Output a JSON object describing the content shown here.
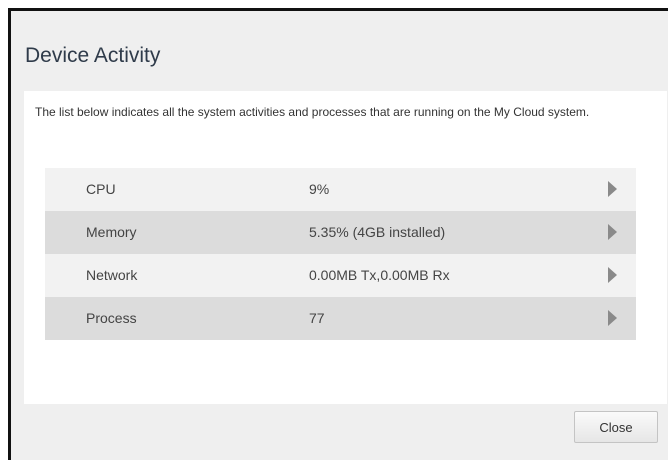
{
  "dialog": {
    "title": "Device Activity",
    "description": "The list below indicates all the system activities and processes that are running on the My Cloud system.",
    "rows": [
      {
        "label": "CPU",
        "value": "9%"
      },
      {
        "label": "Memory",
        "value": "5.35% (4GB installed)"
      },
      {
        "label": "Network",
        "value": "0.00MB Tx,0.00MB Rx"
      },
      {
        "label": "Process",
        "value": "77"
      }
    ],
    "close_label": "Close"
  },
  "icons": {
    "row_arrow": "chevron-right-icon"
  },
  "colors": {
    "title": "#2f3b4a",
    "row_odd": "#f2f2f2",
    "row_even": "#dcdcdc",
    "arrow": "#8a8a8a"
  }
}
